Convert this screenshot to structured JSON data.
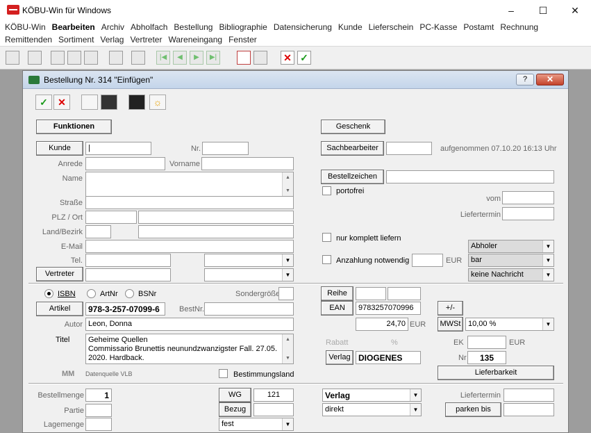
{
  "window": {
    "title": "KÖBU-Win für Windows",
    "min": "–",
    "max": "☐",
    "close": "✕"
  },
  "menu": {
    "row1": [
      "KÖBU-Win",
      "Bearbeiten",
      "Archiv",
      "Abholfach",
      "Bestellung",
      "Bibliographie",
      "Datensicherung",
      "Kunde",
      "Lieferschein",
      "PC-Kasse",
      "Postamt",
      "Rechnung"
    ],
    "row2": [
      "Remittenden",
      "Sortiment",
      "Verlag",
      "Vertreter",
      "Wareneingang",
      "Fenster"
    ]
  },
  "dialog": {
    "title": "Bestellung Nr. 314 \"Einfügen\"",
    "help": "?",
    "close": "✕",
    "tool": {
      "ok": "✓",
      "cancel": "✕",
      "star": "☼"
    },
    "top": {
      "funktionen": "Funktionen",
      "geschenk": "Geschenk",
      "kunde": "Kunde",
      "nr_label": "Nr.",
      "anrede": "Anrede",
      "vorname": "Vorname",
      "name": "Name",
      "strasse": "Straße",
      "plz_ort": "PLZ / Ort",
      "land": "Land/Bezirk",
      "email": "E-Mail",
      "tel": "Tel.",
      "vertreter": "Vertreter",
      "sachbearbeiter": "Sachbearbeiter",
      "aufgenommen": "aufgenommen 07.10.20  16:13 Uhr",
      "bestellzeichen": "Bestellzeichen",
      "portofrei": "portofrei",
      "vom": "vom",
      "liefertermin": "Liefertermin",
      "nur_komplett": "nur komplett liefern",
      "anzahlung": "Anzahlung notwendig",
      "eur": "EUR",
      "abholer": "Abholer",
      "zahlung": "bar",
      "nachricht": "keine Nachricht"
    },
    "article": {
      "isbn": "ISBN",
      "artnr": "ArtNr",
      "bsnr": "BSNr",
      "sondergroesse": "Sondergröße",
      "reihe": "Reihe",
      "artikel": "Artikel",
      "isbn_value": "978-3-257-07099-6",
      "bestnr": "BestNr.",
      "ean": "EAN",
      "ean_value": "9783257070996",
      "plusminus": "+/-",
      "autor_label": "Autor",
      "autor": "Leon, Donna",
      "preis": "24,70",
      "preis_eur": "EUR",
      "mwst": "MWSt",
      "mwst_value": "10,00 %",
      "titel_label": "Titel",
      "titel_lines": [
        "Geheime Quellen",
        "Commissario Brunettis neunundzwanzigster Fall. 27.05.",
        "2020. Hardback."
      ],
      "rabatt": "Rabatt",
      "prozent": "%",
      "ek": "EK",
      "ek_eur": "EUR",
      "verlag": "Verlag",
      "verlag_value": "DIOGENES",
      "nr_label": "Nr",
      "nr_value": "135",
      "mm": "MM",
      "datenquelle": "Datenquelle VLB",
      "bestimmungsland": "Bestimmungsland",
      "lieferbarkeit": "Lieferbarkeit"
    },
    "bottom": {
      "bestellmenge": "Bestellmenge",
      "bestellmenge_value": "1",
      "partie": "Partie",
      "lagemenge": "Lagemenge",
      "wg": "WG",
      "wg_value": "121",
      "bezug": "Bezug",
      "bezug_value": "fest",
      "verlag_sel": "Verlag",
      "direkt_sel": "direkt",
      "liefertermin": "Liefertermin",
      "parken": "parken bis"
    }
  }
}
